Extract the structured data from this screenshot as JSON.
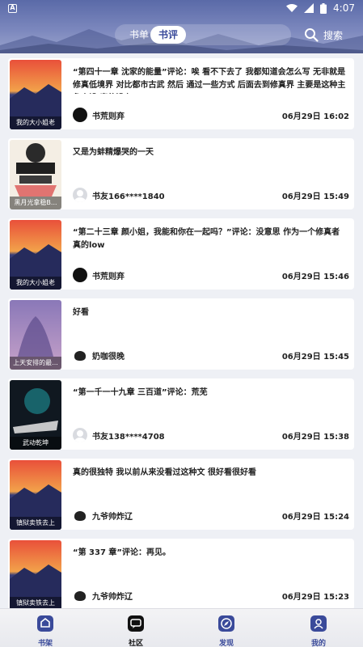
{
  "status": {
    "notice_icon": "A",
    "time": "4:07"
  },
  "header": {
    "tabs": [
      {
        "label": "书单",
        "active": false
      },
      {
        "label": "书评",
        "active": true
      }
    ],
    "search_label": "搜索"
  },
  "reviews": [
    {
      "cover_caption": "我的大小姐老",
      "cover_style": "sunset",
      "text": "“第四十一章 沈家的能量”评论：唉 看不下去了 我都知道会怎么写 无非就是修真低境界 对比都市古武 然后 通过一些方式 后面去到修真界 主要是这种主角人设 真的没有...",
      "user": "书荒则弃",
      "avatar": "black",
      "date": "06月29日 16:02"
    },
    {
      "cover_caption": "黑月光拿稳B...",
      "cover_style": "anime",
      "text": "又是为蚌精爆哭的一天",
      "user": "书友166****1840",
      "avatar": "grey",
      "date": "06月29日 15:49"
    },
    {
      "cover_caption": "我的大小姐老",
      "cover_style": "sunset",
      "text": "“第二十三章 颜小姐，我能和你在一起吗？”评论：没意思 作为一个修真者 真的low",
      "user": "书荒则弃",
      "avatar": "black",
      "date": "06月29日 15:46"
    },
    {
      "cover_caption": "上天安排的最...",
      "cover_style": "purple",
      "text": "好看",
      "user": "奶咖很晚",
      "avatar": "cat",
      "date": "06月29日 15:45"
    },
    {
      "cover_caption": "武动乾坤",
      "cover_style": "dark",
      "text": "“第一千一十九章 三百道”评论：荒芜",
      "user": "书友138****4708",
      "avatar": "grey",
      "date": "06月29日 15:38"
    },
    {
      "cover_caption": "镇狱卖铁去上",
      "cover_style": "sunset",
      "text": "真的很独特 我以前从来没看过这种文 很好看很好看",
      "user": "九爷帅炸辽",
      "avatar": "cat",
      "date": "06月29日 15:24"
    },
    {
      "cover_caption": "镇狱卖铁去上",
      "cover_style": "sunset",
      "text": "“第 337 章”评论：再见。",
      "user": "九爷帅炸辽",
      "avatar": "cat",
      "date": "06月29日 15:23"
    }
  ],
  "tabbar": {
    "items": [
      {
        "label": "书架",
        "icon": "bookshelf-icon",
        "active": false
      },
      {
        "label": "社区",
        "icon": "community-icon",
        "active": true
      },
      {
        "label": "发现",
        "icon": "discover-icon",
        "active": false
      },
      {
        "label": "我的",
        "icon": "profile-icon",
        "active": false
      }
    ]
  },
  "colors": {
    "accent": "#3a4a9a",
    "header": "#6b78b3"
  }
}
